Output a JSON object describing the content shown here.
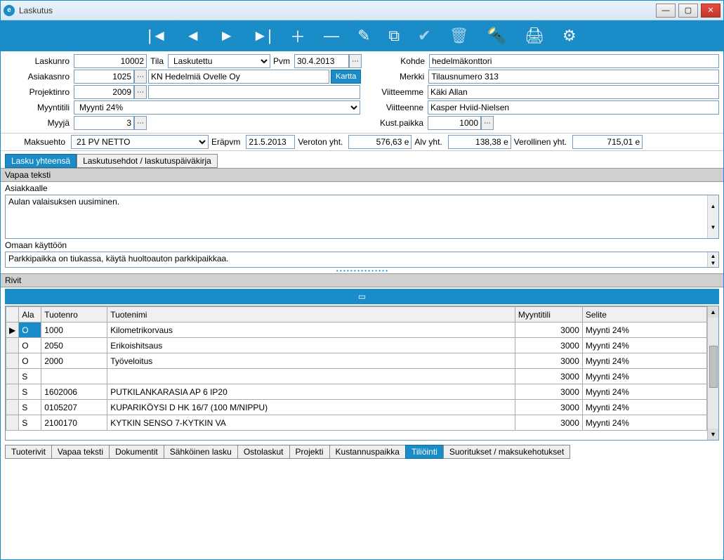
{
  "window": {
    "title": "Laskutus",
    "icon_letter": "e"
  },
  "toolbar_icons": [
    "first",
    "prev",
    "next",
    "last",
    "add",
    "remove",
    "edit",
    "copy",
    "approve",
    "trash",
    "search",
    "print",
    "settings"
  ],
  "labels": {
    "laskunro": "Laskunro",
    "tila": "Tila",
    "pvm": "Pvm",
    "kohde": "Kohde",
    "asiakasnro": "Asiakasnro",
    "merkki": "Merkki",
    "projektinro": "Projektinro",
    "viitteemme": "Viitteemme",
    "myyntitili": "Myyntitili",
    "viitteenne": "Viitteenne",
    "myyja": "Myyjä",
    "kustpaikka": "Kust.paikka",
    "maksuehto": "Maksuehto",
    "erapvm": "Eräpvm",
    "veroton_yht": "Veroton yht.",
    "alv_yht": "Alv yht.",
    "verollinen_yht": "Verollinen yht.",
    "kartta": "Kartta",
    "vapaa_teksti": "Vapaa teksti",
    "asiakkaalle": "Asiakkaalle",
    "omaan_kayttoon": "Omaan käyttöön",
    "rivit": "Rivit"
  },
  "fields": {
    "laskunro": "10002",
    "tila": "Laskutettu",
    "pvm": "30.4.2013",
    "kohde": "hedelmäkonttori",
    "asiakasnro": "1025",
    "asiakas_nimi": "KN Hedelmiä Ovelle Oy",
    "merkki": "Tilausnumero 313",
    "projektinro": "2009",
    "projekti_nimi": "",
    "viitteemme": "Käki Allan",
    "myyntitili": "Myynti 24%",
    "viitteenne": "Kasper Hviid-Nielsen",
    "myyja": "3",
    "kustpaikka": "1000",
    "maksuehto": "21 PV NETTO",
    "erapvm": "21.5.2013",
    "veroton_yht": "576,63 e",
    "alv_yht": "138,38 e",
    "verollinen_yht": "715,01 e",
    "asiakkaalle_text": "Aulan valaisuksen uusiminen.",
    "omaan_text": "Parkkipaikka on tiukassa, käytä huoltoauton parkkipaikkaa."
  },
  "tabs_top": [
    "Lasku yhteensä",
    "Laskutusehdot / laskutuspäiväkirja"
  ],
  "tabs_top_active": 0,
  "grid": {
    "headers": [
      "",
      "Ala",
      "Tuotenro",
      "Tuotenimi",
      "Myyntitili",
      "Selite"
    ],
    "rows": [
      {
        "marker": "▶",
        "ala": "O",
        "tuotenro": "1000",
        "tuotenimi": "Kilometrikorvaus",
        "myyntitili": "3000",
        "selite": "Myynti 24%",
        "sel": true
      },
      {
        "marker": "",
        "ala": "O",
        "tuotenro": "2050",
        "tuotenimi": "Erikoishitsaus",
        "myyntitili": "3000",
        "selite": "Myynti 24%"
      },
      {
        "marker": "",
        "ala": "O",
        "tuotenro": "2000",
        "tuotenimi": "Työveloitus",
        "myyntitili": "3000",
        "selite": "Myynti 24%"
      },
      {
        "marker": "",
        "ala": "S",
        "tuotenro": "",
        "tuotenimi": "",
        "myyntitili": "3000",
        "selite": "Myynti 24%"
      },
      {
        "marker": "",
        "ala": "S",
        "tuotenro": "1602006",
        "tuotenimi": "PUTKILANKARASIA AP 6 IP20",
        "myyntitili": "3000",
        "selite": "Myynti 24%"
      },
      {
        "marker": "",
        "ala": "S",
        "tuotenro": "0105207",
        "tuotenimi": "KUPARIKÖYSI D HK 16/7 (100 M/NIPPU)",
        "myyntitili": "3000",
        "selite": "Myynti 24%"
      },
      {
        "marker": "",
        "ala": "S",
        "tuotenro": "2100170",
        "tuotenimi": "KYTKIN SENSO 7-KYTKIN VA",
        "myyntitili": "3000",
        "selite": "Myynti 24%"
      }
    ]
  },
  "tabs_bottom": [
    "Tuoterivit",
    "Vapaa teksti",
    "Dokumentit",
    "Sähköinen lasku",
    "Ostolaskut",
    "Projekti",
    "Kustannuspaikka",
    "Tiliöinti",
    "Suoritukset / maksukehotukset"
  ],
  "tabs_bottom_active": 7,
  "currency_suffix": "e"
}
